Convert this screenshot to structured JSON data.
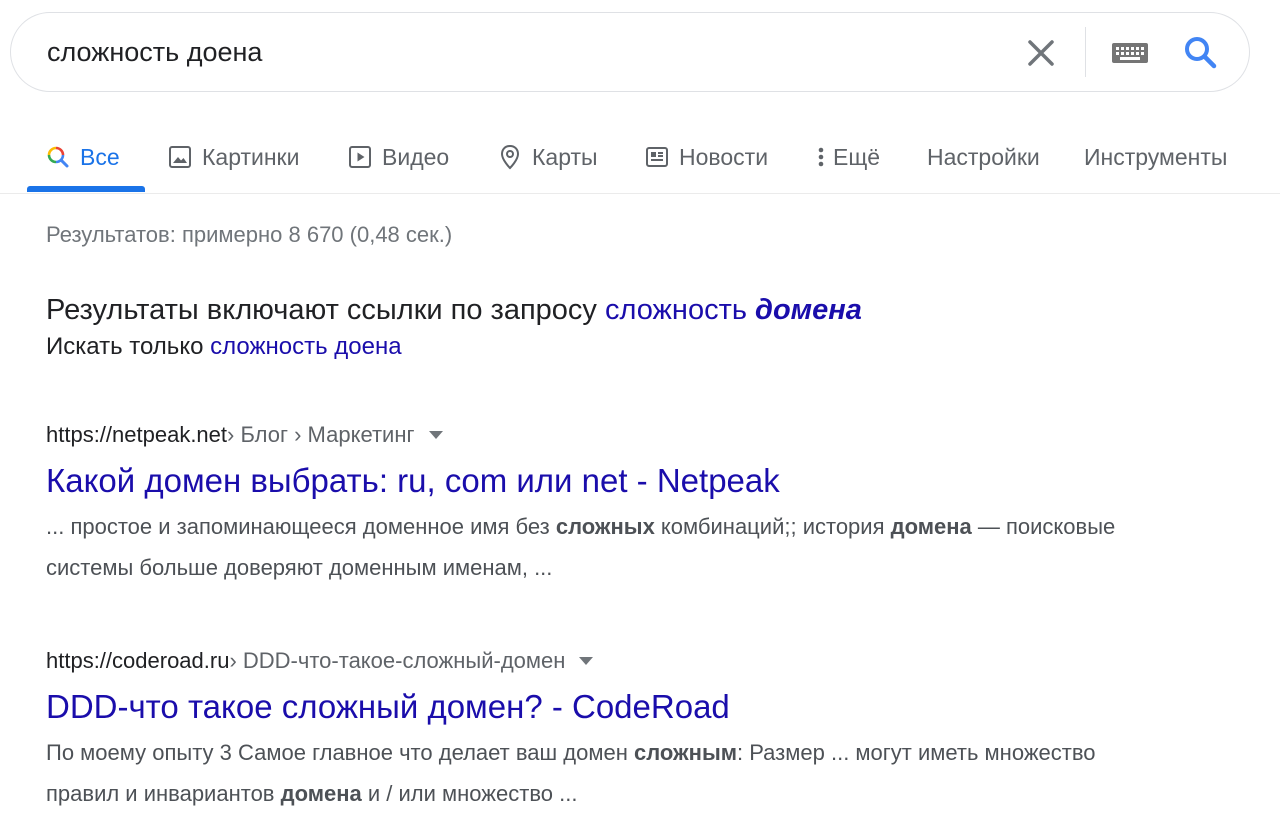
{
  "search": {
    "query": "сложность доена"
  },
  "tabs": [
    {
      "label": "Все",
      "icon": "search-icon"
    },
    {
      "label": "Картинки",
      "icon": "image-icon"
    },
    {
      "label": "Видео",
      "icon": "play-icon"
    },
    {
      "label": "Карты",
      "icon": "map-pin-icon"
    },
    {
      "label": "Новости",
      "icon": "news-icon"
    },
    {
      "label": "Ещё",
      "icon": "more-vert-icon"
    },
    {
      "label": "Настройки"
    },
    {
      "label": "Инструменты"
    }
  ],
  "stats": "Результатов: примерно 8 670 (0,48 сек.)",
  "correction": {
    "prefix": "Результаты включают ссылки по запросу",
    "corrected_plain": "сложность",
    "corrected_bold": "домена",
    "original_prefix": "Искать только",
    "original_link": "сложность доена"
  },
  "results": [
    {
      "domain": "https://netpeak.net",
      "path": " › Блог › Маркетинг",
      "title": "Какой домен выбрать: ru, com или net - Netpeak",
      "snippet": [
        {
          "t": "... простое и запоминающееся доменное имя без ",
          "b": false
        },
        {
          "t": "сложных",
          "b": true
        },
        {
          "t": " комбинаций;; история ",
          "b": false
        },
        {
          "t": "домена",
          "b": true
        },
        {
          "t": " — поисковые системы больше доверяют доменным именам, ...",
          "b": false
        }
      ]
    },
    {
      "domain": "https://coderoad.ru",
      "path": " › DDD-что-такое-сложный-домен",
      "title": "DDD-что такое сложный домен? - CodeRoad",
      "snippet": [
        {
          "t": "По моему опыту 3 Самое главное что делает ваш домен ",
          "b": false
        },
        {
          "t": "сложным",
          "b": true
        },
        {
          "t": ": Размер ... могут иметь множество правил и инвариантов ",
          "b": false
        },
        {
          "t": "домена",
          "b": true
        },
        {
          "t": " и / или множество ...",
          "b": false
        }
      ]
    }
  ],
  "colors": {
    "accent": "#1a73e8",
    "link": "#1a0dab",
    "muted": "#5f6368",
    "snippet": "#4d5156"
  }
}
